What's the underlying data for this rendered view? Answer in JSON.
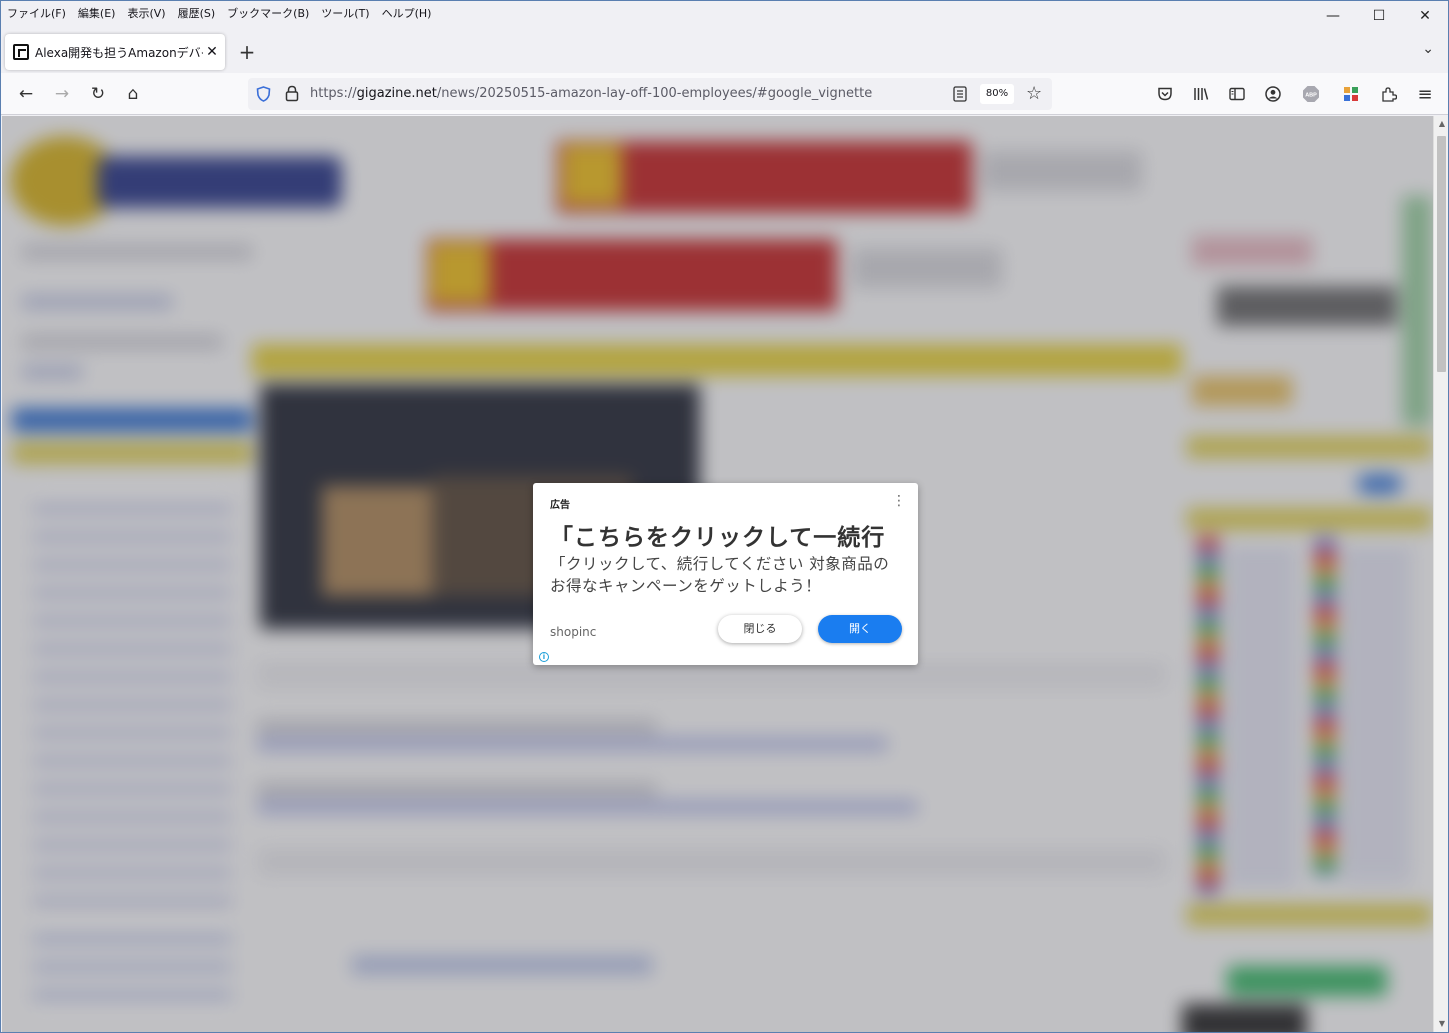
{
  "menubar": {
    "items": [
      "ファイル(F)",
      "編集(E)",
      "表示(V)",
      "履歴(S)",
      "ブックマーク(B)",
      "ツール(T)",
      "ヘルプ(H)"
    ]
  },
  "window_controls": {
    "minimize": "—",
    "maximize": "☐",
    "close": "✕"
  },
  "tab": {
    "title": "Alexa開発も担うAmazonデバイス·",
    "close": "✕"
  },
  "new_tab": "+",
  "tab_list": "⌄",
  "nav": {
    "back": "←",
    "forward": "→",
    "reload": "↻",
    "home": "⌂"
  },
  "urlbar": {
    "scheme": "https://",
    "domain": "gigazine.net",
    "path": "/news/20250515-amazon-lay-off-100-employees/#google_vignette",
    "zoom": "80%",
    "star": "☆"
  },
  "toolbar_icons": [
    "pocket-icon",
    "library-icon",
    "sidebar-icon",
    "account-icon",
    "adblock-icon",
    "extension-grid-icon",
    "extensions-icon",
    "menu-icon"
  ],
  "toolbar": {
    "abp": "ABP",
    "menu": "≡"
  },
  "ad": {
    "label": "広告",
    "menu": "⋮",
    "headline": "「こちらをクリックして一続行",
    "body": "「クリックして、続行してください 対象商品のお得なキャンペーンをゲットしよう！",
    "advertiser": "shopinc",
    "close_label": "閉じる",
    "open_label": "開く",
    "info": "i"
  },
  "scrollbar": {
    "up": "▲",
    "down": "▼"
  },
  "colors": {
    "accent_blue": "#1a7df0",
    "site_yellow": "#e8d23a",
    "site_red": "#cc2a2a"
  }
}
